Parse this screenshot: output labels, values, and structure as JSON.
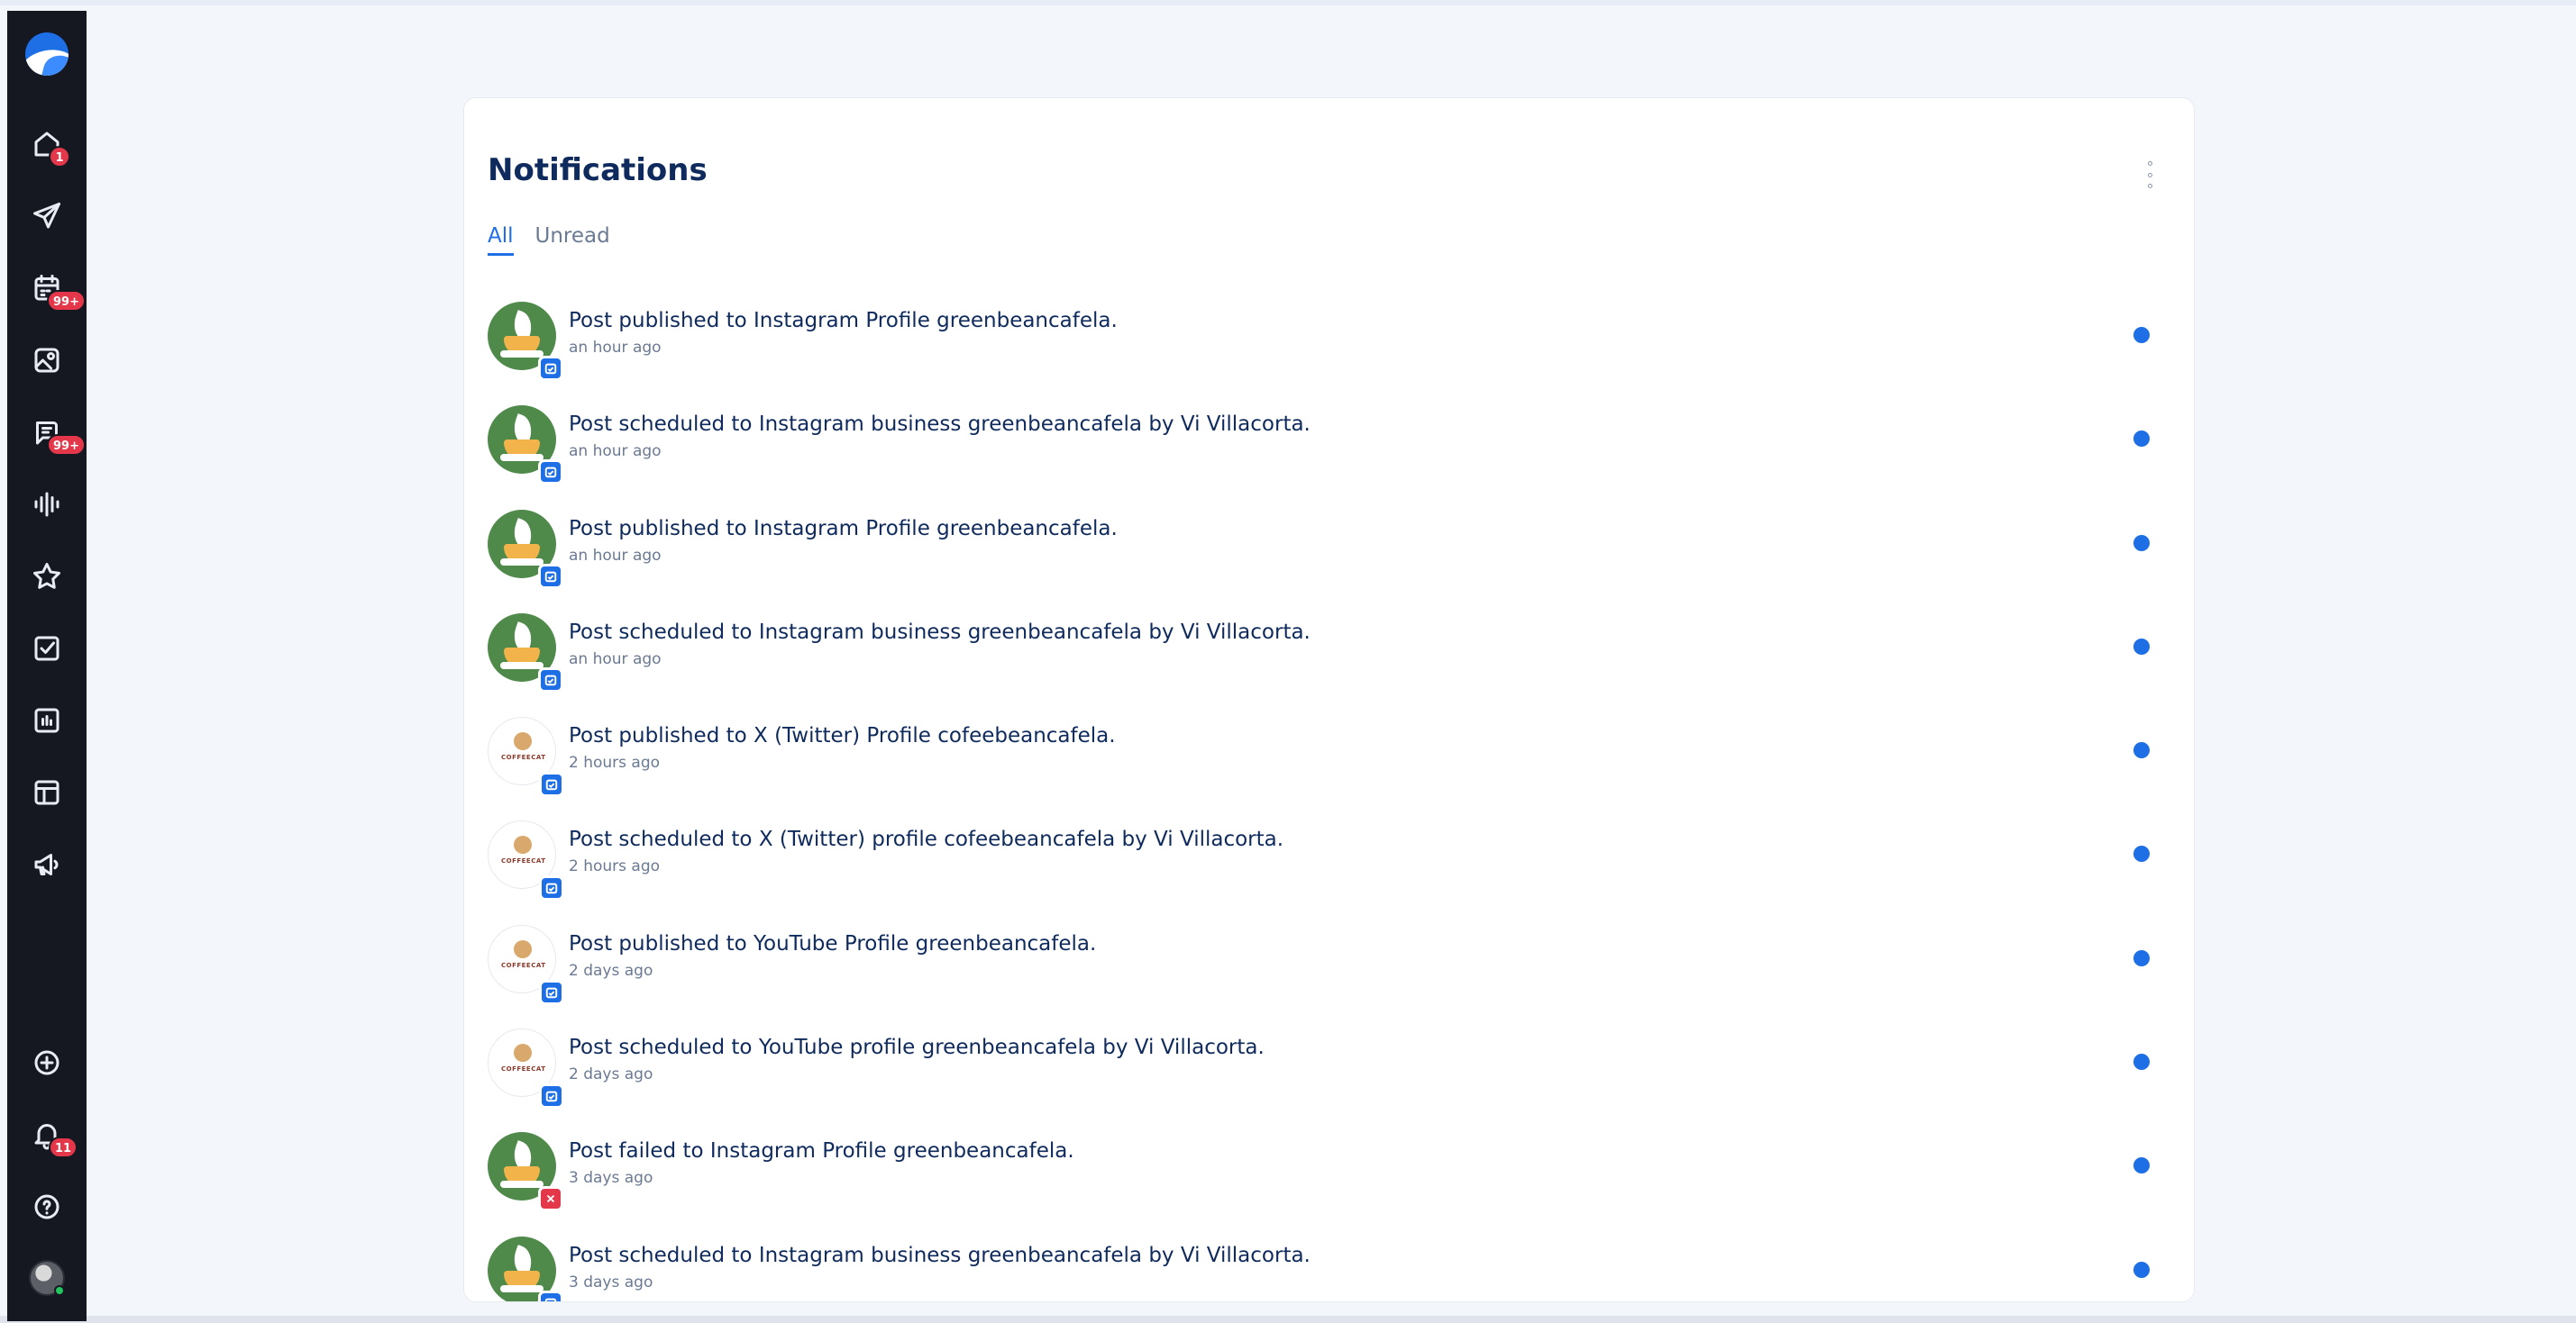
{
  "sidebar": {
    "badges": {
      "home": "1",
      "calendar": "99+",
      "inbox": "99+",
      "notifications": "11"
    }
  },
  "page": {
    "title": "Notifications",
    "tabs": [
      {
        "label": "All",
        "active": true
      },
      {
        "label": "Unread",
        "active": false
      }
    ]
  },
  "notifications": [
    {
      "message": "Post published to Instagram Profile greenbeancafela.",
      "time": "an hour ago",
      "avatar": "greenbean",
      "status": "ok"
    },
    {
      "message": "Post scheduled to Instagram business greenbeancafela by Vi Villacorta.",
      "time": "an hour ago",
      "avatar": "greenbean",
      "status": "ok"
    },
    {
      "message": "Post published to Instagram Profile greenbeancafela.",
      "time": "an hour ago",
      "avatar": "greenbean",
      "status": "ok"
    },
    {
      "message": "Post scheduled to Instagram business greenbeancafela by Vi Villacorta.",
      "time": "an hour ago",
      "avatar": "greenbean",
      "status": "ok"
    },
    {
      "message": "Post published to X (Twitter) Profile cofeebeancafela.",
      "time": "2 hours ago",
      "avatar": "coffeecat",
      "status": "ok"
    },
    {
      "message": "Post scheduled to X (Twitter) profile cofeebeancafela by Vi Villacorta.",
      "time": "2 hours ago",
      "avatar": "coffeecat",
      "status": "ok"
    },
    {
      "message": "Post published to YouTube Profile greenbeancafela.",
      "time": "2 days ago",
      "avatar": "coffeecat",
      "status": "ok"
    },
    {
      "message": "Post scheduled to YouTube profile greenbeancafela by Vi Villacorta.",
      "time": "2 days ago",
      "avatar": "coffeecat",
      "status": "ok"
    },
    {
      "message": "Post failed to Instagram Profile greenbeancafela.",
      "time": "3 days ago",
      "avatar": "greenbean",
      "status": "fail"
    },
    {
      "message": "Post scheduled to Instagram business greenbeancafela by Vi Villacorta.",
      "time": "3 days ago",
      "avatar": "greenbean",
      "status": "ok"
    }
  ],
  "avatar_logo_text": "COFFEECAT",
  "colors": {
    "accent": "#1e6fe6",
    "sidebar_bg": "#151821",
    "badge": "#e5374a",
    "title": "#0f2a5c"
  }
}
